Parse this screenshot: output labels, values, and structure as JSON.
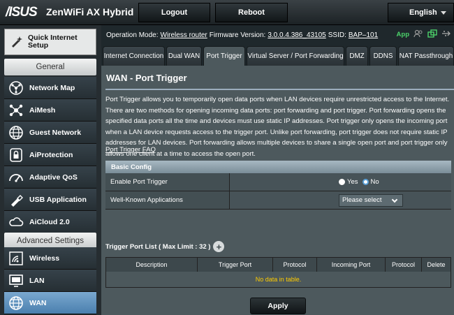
{
  "header": {
    "brand": "/ISUS",
    "product": "ZenWiFi AX Hybrid",
    "logout": "Logout",
    "reboot": "Reboot",
    "language": "English"
  },
  "sidebar": {
    "quick_setup": "Quick Internet Setup",
    "general_title": "General",
    "general_items": [
      {
        "label": "Network Map",
        "icon": "network-map-icon"
      },
      {
        "label": "AiMesh",
        "icon": "aimesh-icon"
      },
      {
        "label": "Guest Network",
        "icon": "guest-network-icon"
      },
      {
        "label": "AiProtection",
        "icon": "lock-icon"
      },
      {
        "label": "Adaptive QoS",
        "icon": "gauge-icon"
      },
      {
        "label": "USB Application",
        "icon": "usb-icon"
      },
      {
        "label": "AiCloud 2.0",
        "icon": "cloud-icon"
      }
    ],
    "advanced_title": "Advanced Settings",
    "advanced_items": [
      {
        "label": "Wireless",
        "icon": "wireless-icon"
      },
      {
        "label": "LAN",
        "icon": "lan-icon"
      },
      {
        "label": "WAN",
        "icon": "globe-icon",
        "active": true
      }
    ]
  },
  "status": {
    "operation_mode_label": "Operation Mode:",
    "operation_mode": "Wireless router",
    "firmware_label": "Firmware Version:",
    "firmware": "3.0.0.4.386_43105",
    "ssid_label": "SSID:",
    "ssid": "BAP–101",
    "app": "App"
  },
  "tabs": [
    {
      "label": "Internet Connection"
    },
    {
      "label": "Dual WAN"
    },
    {
      "label": "Port Trigger",
      "active": true
    },
    {
      "label": "Virtual Server / Port Forwarding"
    },
    {
      "label": "DMZ"
    },
    {
      "label": "DDNS"
    },
    {
      "label": "NAT Passthrough"
    }
  ],
  "page": {
    "title": "WAN - Port Trigger",
    "description": "Port Trigger allows you to temporarily open data ports when LAN devices require unrestricted access to the Internet. There are two methods for opening incoming data ports: port forwarding and port trigger. Port forwarding opens the specified data ports all the time and devices must use static IP addresses. Port trigger only opens the incoming port when a LAN device requests access to the trigger port. Unlike port forwarding, port trigger does not require static IP addresses for LAN devices. Port forwarding allows multiple devices to share a single open port and port trigger only allows one client at a time to access the open port.",
    "faq": "Port Trigger FAQ",
    "basic_config": "Basic Config",
    "enable_label": "Enable Port Trigger",
    "yes": "Yes",
    "no": "No",
    "enable_value": "No",
    "apps_label": "Well-Known Applications",
    "apps_select": "Please select",
    "list_title": "Trigger Port List ( Max Limit : 32 )",
    "columns": [
      "Description",
      "Trigger Port",
      "Protocol",
      "Incoming Port",
      "Protocol",
      "Delete"
    ],
    "empty": "No data in table.",
    "apply": "Apply"
  },
  "colors": {
    "background": "#1f282c",
    "panel": "#4d595d",
    "active_nav": "#5a8fc0",
    "empty_text": "#ffcc00",
    "app_green": "#4bd26a"
  }
}
